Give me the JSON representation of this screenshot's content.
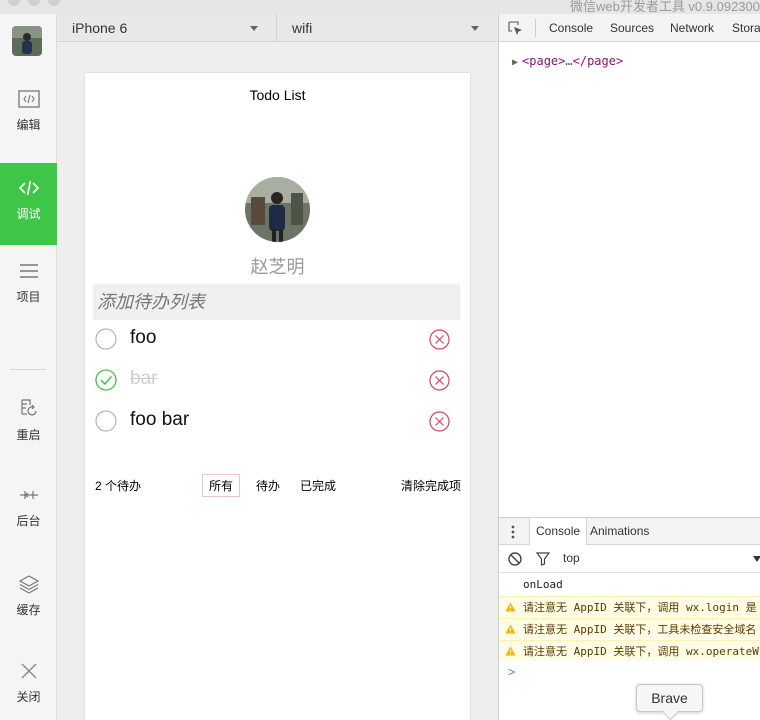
{
  "window": {
    "title": "微信web开发者工具 v0.9.092300"
  },
  "sidebar": {
    "items": [
      {
        "label": "编辑",
        "icon": "code-file-icon"
      },
      {
        "label": "调试",
        "icon": "debug-code-icon",
        "active": true
      },
      {
        "label": "项目",
        "icon": "menu-lines-icon"
      },
      {
        "label": "重启",
        "icon": "restart-icon"
      },
      {
        "label": "后台",
        "icon": "background-icon"
      },
      {
        "label": "缓存",
        "icon": "layers-icon"
      },
      {
        "label": "关闭",
        "icon": "close-icon"
      }
    ]
  },
  "device_toolbar": {
    "device": "iPhone 6",
    "network": "wifi"
  },
  "app": {
    "title": "Todo List",
    "username": "赵芝明",
    "input_placeholder": "添加待办列表",
    "todos": [
      {
        "text": "foo",
        "done": false
      },
      {
        "text": "bar",
        "done": true
      },
      {
        "text": "foo bar",
        "done": false
      }
    ],
    "footer": {
      "count_label": "2 个待办",
      "filters": [
        "所有",
        "待办",
        "已完成"
      ],
      "selected_filter": "所有",
      "clear_label": "清除完成项"
    }
  },
  "devtools": {
    "tabs": [
      "Console",
      "Sources",
      "Network",
      "Storag"
    ],
    "elements": {
      "open_tag": "<page>",
      "ellipsis": "…",
      "close_tag": "</page>"
    },
    "drawer_tabs": [
      "Console",
      "Animations"
    ],
    "context": "top",
    "logs": [
      {
        "level": "log",
        "text": "onLoad"
      },
      {
        "level": "warning",
        "text": "请注意无 AppID 关联下，调用 wx.login 是"
      },
      {
        "level": "warning",
        "text": "请注意无 AppID 关联下，工具未检查安全域名"
      },
      {
        "level": "warning",
        "text": "请注意无 AppID 关联下，调用 wx.operateW"
      }
    ],
    "prompt": ">"
  },
  "tooltip": {
    "label": "Brave"
  },
  "colors": {
    "accent_green": "#3fc548",
    "delete_red": "#d0465a",
    "warning_bg": "#fffbe5",
    "xml_tag": "#881280"
  }
}
